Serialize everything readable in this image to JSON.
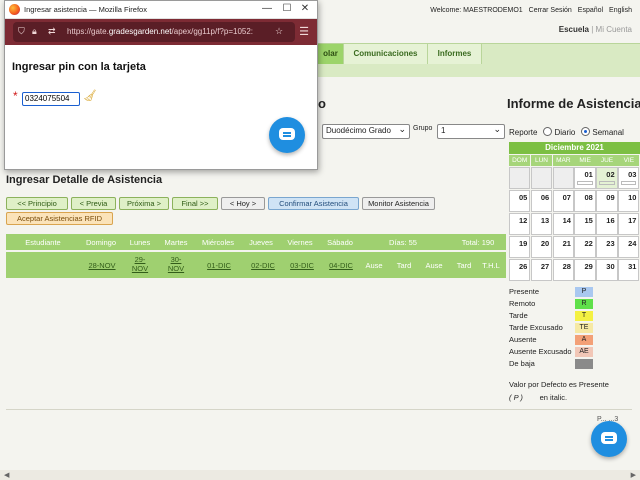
{
  "topbar": {
    "welcome": "Welcome: MAESTRODEMO1",
    "logout": "Cerrar Sesión",
    "lang_es": "Español",
    "lang_en": "English"
  },
  "schoolbar": {
    "school": "Escuela",
    "sep": " | ",
    "my_account": "Mi Cuenta"
  },
  "nav": {
    "tabs": [
      {
        "label": "olar"
      },
      {
        "label": "Comunicaciones"
      },
      {
        "label": "Informes"
      }
    ]
  },
  "page": {
    "heading_partial": "o",
    "informe_title": "Informe de Asistencia"
  },
  "filters": {
    "grade_value": "Duodécimo Grado",
    "group_label": "Grupo",
    "group_value": "1",
    "report_label": "Reporte",
    "daily": "Diario",
    "weekly": "Semanal"
  },
  "attendance": {
    "title": "Ingresar Detalle de Asistencia",
    "buttons": {
      "start": "<< Principio",
      "prev": "< Previa",
      "next": "Próxima >",
      "end": "Final >>",
      "today": "< Hoy >",
      "confirm": "Confirmar Asistencia",
      "monitor": "Monitor Asistencia",
      "rfid": "Aceptar Asistencias RFID"
    },
    "headers": {
      "student": "Estudiante",
      "sun": "Domingo",
      "mon": "Lunes",
      "tue": "Martes",
      "wed": "Miércoles",
      "thu": "Jueves",
      "fri": "Viernes",
      "sat": "Sábado",
      "days": "Días: 55",
      "total": "Total: 190"
    },
    "dates": [
      "28-NOV",
      "29-NOV",
      "30-NOV",
      "01-DIC",
      "02-DIC",
      "03-DIC",
      "04-DIC"
    ],
    "dates_split": {
      "d29a": "29-",
      "d29b": "NOV",
      "d30a": "30-",
      "d30b": "NOV"
    },
    "summary_cols": [
      "Ause",
      "Tard",
      "Ause",
      "Tard",
      "T.H.L"
    ]
  },
  "calendar": {
    "title": "Diciembre 2021",
    "days": [
      "DOM",
      "LUN",
      "MAR",
      "MIE",
      "JUE",
      "VIE"
    ],
    "weeks": [
      [
        "",
        "",
        "",
        "01",
        "02",
        "03"
      ],
      [
        "05",
        "06",
        "07",
        "08",
        "09",
        "10"
      ],
      [
        "12",
        "13",
        "14",
        "15",
        "16",
        "17"
      ],
      [
        "19",
        "20",
        "21",
        "22",
        "23",
        "24"
      ],
      [
        "26",
        "27",
        "28",
        "29",
        "30",
        "31"
      ]
    ]
  },
  "legend": {
    "items": [
      {
        "label": "Presente",
        "code": "P",
        "color": "#a9c8f0"
      },
      {
        "label": "Remoto",
        "code": "R",
        "color": "#5fe04a"
      },
      {
        "label": "Tarde",
        "code": "T",
        "color": "#f4f142"
      },
      {
        "label": "Tarde Excusado",
        "code": "TE",
        "color": "#f6e9a4"
      },
      {
        "label": "Ausente",
        "code": "A",
        "color": "#f3a077"
      },
      {
        "label": "Ausente Excusado",
        "code": "AE",
        "color": "#f2c7b7"
      },
      {
        "label": "De baja",
        "code": "",
        "color": "#8a8a8a"
      }
    ],
    "default_text": "Valor por Defecto es Presente",
    "default_code": "( P )",
    "italic_text": "en italic."
  },
  "footer": {
    "page_partial": "P... ...3"
  },
  "popup": {
    "window_title": "Ingresar asistencia — Mozilla Firefox",
    "url_prefix": "https://gate.",
    "url_domain": "gradesgarden.net",
    "url_suffix": "/apex/gg11p/f?p=1052:",
    "heading": "Ingresar pin con la tarjeta",
    "required_mark": "*",
    "pin_value": "0324075504"
  }
}
